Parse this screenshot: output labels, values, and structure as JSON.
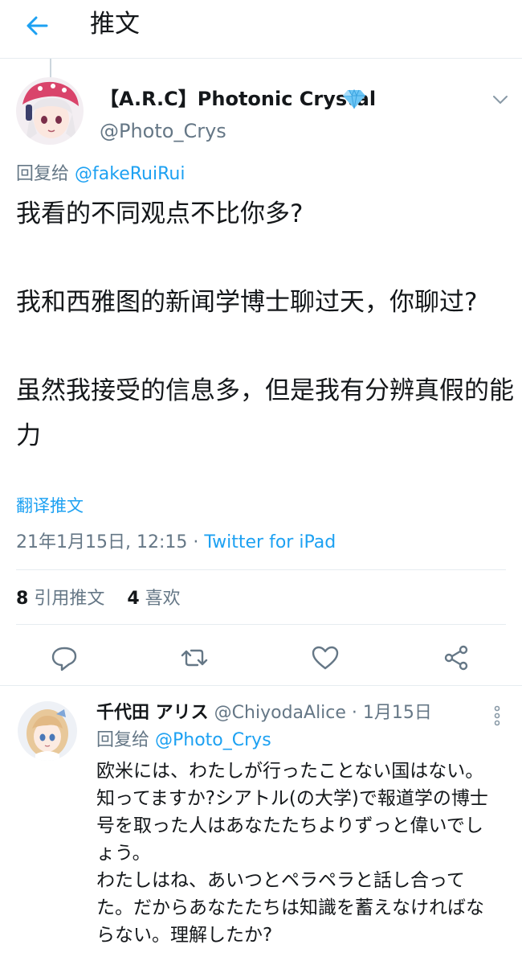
{
  "header": {
    "title": "推文"
  },
  "tweet": {
    "display_name": "【A.R.C】Photonic Crystal",
    "handle": "@Photo_Crys",
    "reply_prefix": "回复给",
    "reply_to": "@fakeRuiRui",
    "paragraphs": [
      "我看的不同观点不比你多?",
      "我和西雅图的新闻学博士聊过天，你聊过?",
      "虽然我接受的信息多，但是我有分辨真假的能力"
    ],
    "translate": "翻译推文",
    "timestamp": "21年1月15日, 12:15",
    "separator": " · ",
    "source": "Twitter for iPad",
    "retweets_count": "8",
    "retweets_label": "引用推文",
    "likes_count": "4",
    "likes_label": "喜欢"
  },
  "reply": {
    "name": "千代田 アリス",
    "handle": "@ChiyodaAlice",
    "date": "· 1月15日",
    "reply_prefix": "回复给",
    "reply_to": "@Photo_Crys",
    "lines": [
      "欧米には、わたしが行ったことない国はない。",
      "知ってますか?シアトル(の大学)で報道学の博士号を取った人はあなたたちよりずっと偉いでしょう。",
      "わたしはね、あいつとペラペラと話し合ってた。だからあなたたちは知識を蓄えなければならない。理解したか?"
    ]
  },
  "colors": {
    "accent": "#1da1f2",
    "secondary_text": "#657786",
    "divider": "#e6ecf0",
    "verified": "#6ec6f5"
  },
  "icons": [
    "back-arrow-icon",
    "verified-diamond-icon",
    "chevron-down-icon",
    "reply-icon",
    "retweet-icon",
    "like-icon",
    "share-icon",
    "more-vertical-icon"
  ]
}
